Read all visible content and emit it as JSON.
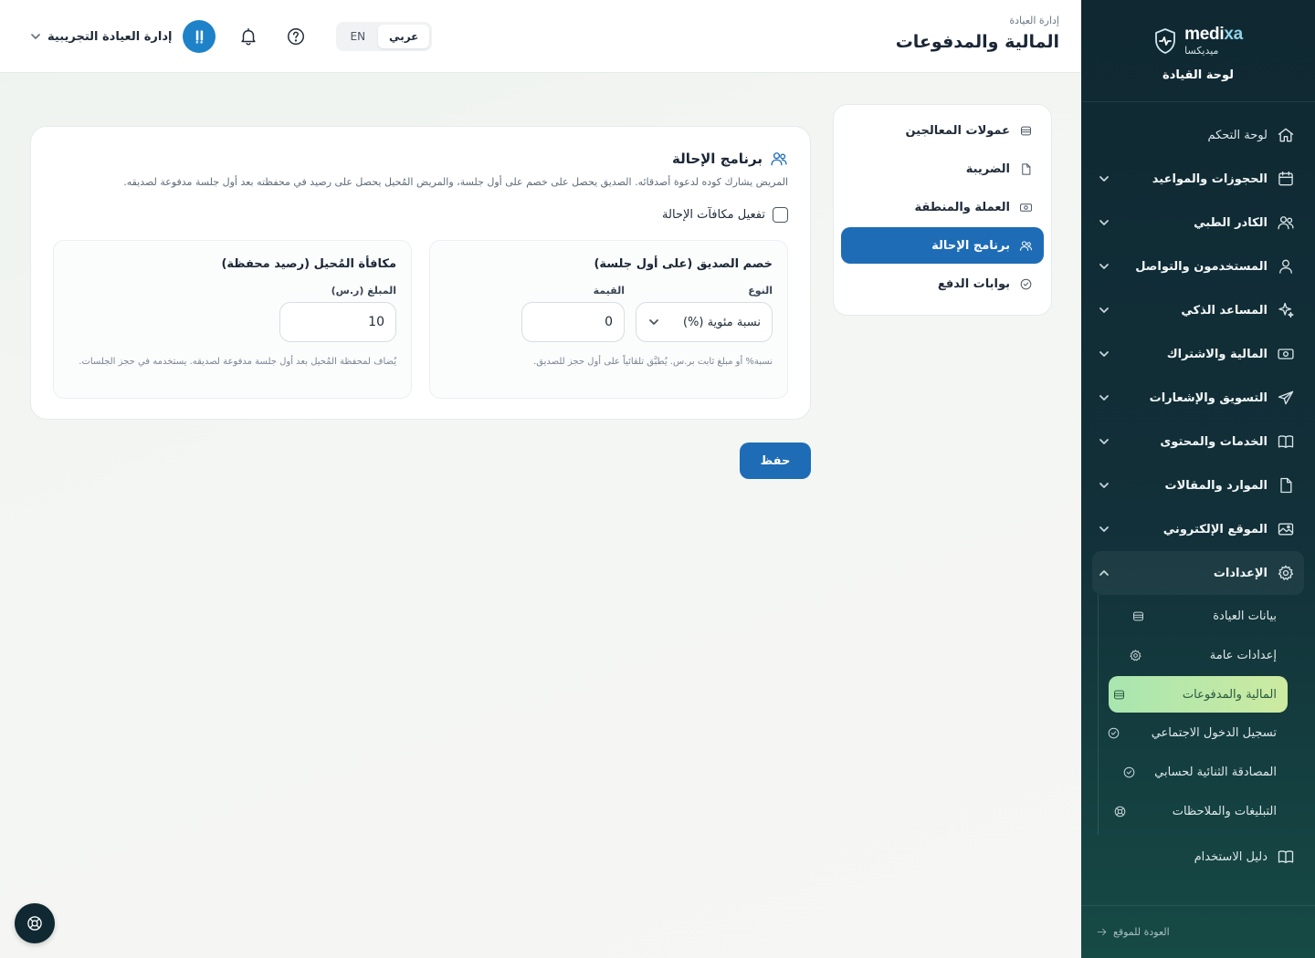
{
  "brand": {
    "name_prefix": "medi",
    "name_suffix": "xa",
    "name_ar": "ميديكسا",
    "subtitle": "لوحة القيادة",
    "logo_icon": "shield-pulse-icon"
  },
  "header": {
    "breadcrumb": "إدارة العيادة",
    "title": "المالية والمدفوعات",
    "user_name": "إدارة العيادة التجريبية",
    "avatar_initials": "إإ",
    "lang_ar": "عربي",
    "lang_en": "EN"
  },
  "sidebar": {
    "items": [
      {
        "label": "لوحة التحكم",
        "icon": "home-icon",
        "expandable": false
      },
      {
        "label": "الحجوزات والمواعيد",
        "icon": "calendar-icon",
        "expandable": true
      },
      {
        "label": "الكادر الطبي",
        "icon": "users-icon",
        "expandable": true
      },
      {
        "label": "المستخدمون والتواصل",
        "icon": "user-icon",
        "expandable": true
      },
      {
        "label": "المساعد الذكي",
        "icon": "sparkles-icon",
        "expandable": true
      },
      {
        "label": "المالية والاشتراك",
        "icon": "banknote-icon",
        "expandable": true
      },
      {
        "label": "التسويق والإشعارات",
        "icon": "send-icon",
        "expandable": true
      },
      {
        "label": "الخدمات والمحتوى",
        "icon": "book-icon",
        "expandable": true
      },
      {
        "label": "الموارد والمقالات",
        "icon": "file-icon",
        "expandable": true
      },
      {
        "label": "الموقع الإلكتروني",
        "icon": "image-icon",
        "expandable": true
      },
      {
        "label": "الإعدادات",
        "icon": "gear-icon",
        "expandable": true,
        "open": true
      }
    ],
    "settings_sub": [
      {
        "label": "بيانات العيادة",
        "icon": "card-icon"
      },
      {
        "label": "إعدادات عامة",
        "icon": "gear-icon"
      },
      {
        "label": "المالية والمدفوعات",
        "icon": "card-icon",
        "active": true
      },
      {
        "label": "تسجيل الدخول الاجتماعي",
        "icon": "check-circle-icon"
      },
      {
        "label": "المصادقة الثنائية لحسابي",
        "icon": "check-circle-icon"
      },
      {
        "label": "التبليغات والملاحظات",
        "icon": "lifebuoy-icon"
      }
    ],
    "guide": "دليل الاستخدام",
    "back": "العودة للموقع"
  },
  "tabs": [
    {
      "label": "عمولات المعالجين",
      "icon": "card-icon"
    },
    {
      "label": "الضريبة",
      "icon": "file-icon"
    },
    {
      "label": "العملة والمنطقة",
      "icon": "banknote-icon"
    },
    {
      "label": "برنامج الإحالة",
      "icon": "users-icon",
      "active": true
    },
    {
      "label": "بوابات الدفع",
      "icon": "check-circle-icon"
    }
  ],
  "referral": {
    "title": "برنامج الإحالة",
    "description": "المريض يشارك كوده لدعوة أصدقائه. الصديق يحصل على خصم على أول جلسة، والمريض المُحيل يحصل على رصيد في محفظته بعد أول جلسة مدفوعة لصديقه.",
    "enable_label": "تفعيل مكافآت الإحالة",
    "enabled": false,
    "friend": {
      "title": "خصم الصديق (على أول جلسة)",
      "type_label": "النوع",
      "type_value": "نسبة مئوية (%)",
      "value_label": "القيمة",
      "value": "0",
      "hint": "نسبة% أو مبلغ ثابت بر.س. يُطبَّق تلقائياً على أول حجز للصديق."
    },
    "referrer": {
      "title": "مكافأة المُحيل (رصيد محفظة)",
      "amount_label": "المبلغ (ر.س)",
      "amount": "10",
      "hint": "يُضاف لمحفظة المُحيل بعد أول جلسة مدفوعة لصديقه. يستخدمه في حجز الجلسات."
    }
  },
  "save_label": "حفظ",
  "colors": {
    "primary": "#1e6cb6",
    "sidebar": "#0f2832",
    "active_sub": "#a8e6b0"
  }
}
